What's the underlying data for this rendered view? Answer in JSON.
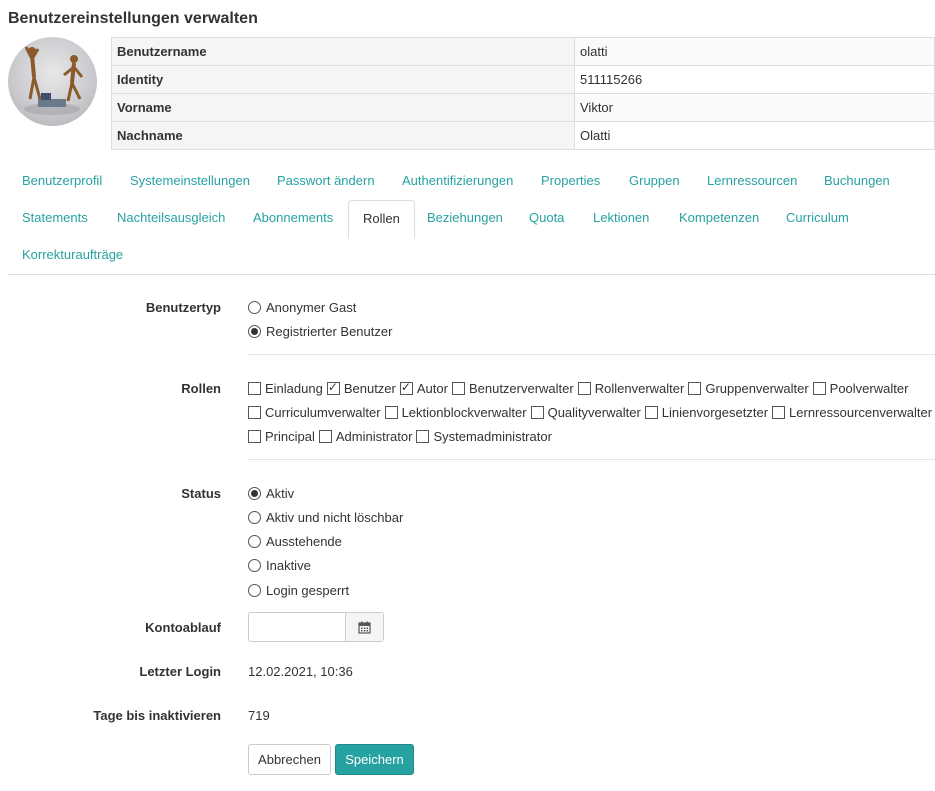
{
  "page": {
    "title": "Benutzereinstellungen verwalten"
  },
  "user_info": [
    {
      "key": "Benutzername",
      "value": "olatti"
    },
    {
      "key": "Identity",
      "value": "511115266"
    },
    {
      "key": "Vorname",
      "value": "Viktor"
    },
    {
      "key": "Nachname",
      "value": "Olatti"
    }
  ],
  "tabs": [
    "Benutzerprofil",
    "Systemeinstellungen",
    "Passwort ändern",
    "Authentifizierungen",
    "Properties",
    "Gruppen",
    "Lernressourcen",
    "Buchungen",
    "Statements",
    "Nachteilsausgleich",
    "Abonnements",
    "Rollen",
    "Beziehungen",
    "Quota",
    "Lektionen",
    "Kompetenzen",
    "Curriculum",
    "Korrekturaufträge"
  ],
  "active_tab": "Rollen",
  "form": {
    "usertype_label": "Benutzertyp",
    "usertype_options": [
      "Anonymer Gast",
      "Registrierter Benutzer"
    ],
    "usertype_selected": "Registrierter Benutzer",
    "roles_label": "Rollen",
    "roles": [
      {
        "label": "Einladung",
        "checked": false
      },
      {
        "label": "Benutzer",
        "checked": true
      },
      {
        "label": "Autor",
        "checked": true
      },
      {
        "label": "Benutzerverwalter",
        "checked": false
      },
      {
        "label": "Rollenverwalter",
        "checked": false
      },
      {
        "label": "Gruppenverwalter",
        "checked": false
      },
      {
        "label": "Poolverwalter",
        "checked": false
      },
      {
        "label": "Curriculumverwalter",
        "checked": false
      },
      {
        "label": "Lektionblockverwalter",
        "checked": false
      },
      {
        "label": "Qualityverwalter",
        "checked": false
      },
      {
        "label": "Linienvorgesetzter",
        "checked": false
      },
      {
        "label": "Lernressourcenverwalter",
        "checked": false
      },
      {
        "label": "Principal",
        "checked": false
      },
      {
        "label": "Administrator",
        "checked": false
      },
      {
        "label": "Systemadministrator",
        "checked": false
      }
    ],
    "status_label": "Status",
    "status_options": [
      "Aktiv",
      "Aktiv und nicht löschbar",
      "Ausstehende",
      "Inaktive",
      "Login gesperrt"
    ],
    "status_selected": "Aktiv",
    "expiry_label": "Kontoablauf",
    "expiry_value": "",
    "last_login_label": "Letzter Login",
    "last_login_value": "12.02.2021, 10:36",
    "days_label": "Tage bis inaktivieren",
    "days_value": "719",
    "cancel_label": "Abbrechen",
    "save_label": "Speichern"
  },
  "colors": {
    "accent": "#27a2a2",
    "text": "#333333",
    "border": "#dddddd"
  },
  "icons": {
    "calendar": "calendar-icon"
  }
}
